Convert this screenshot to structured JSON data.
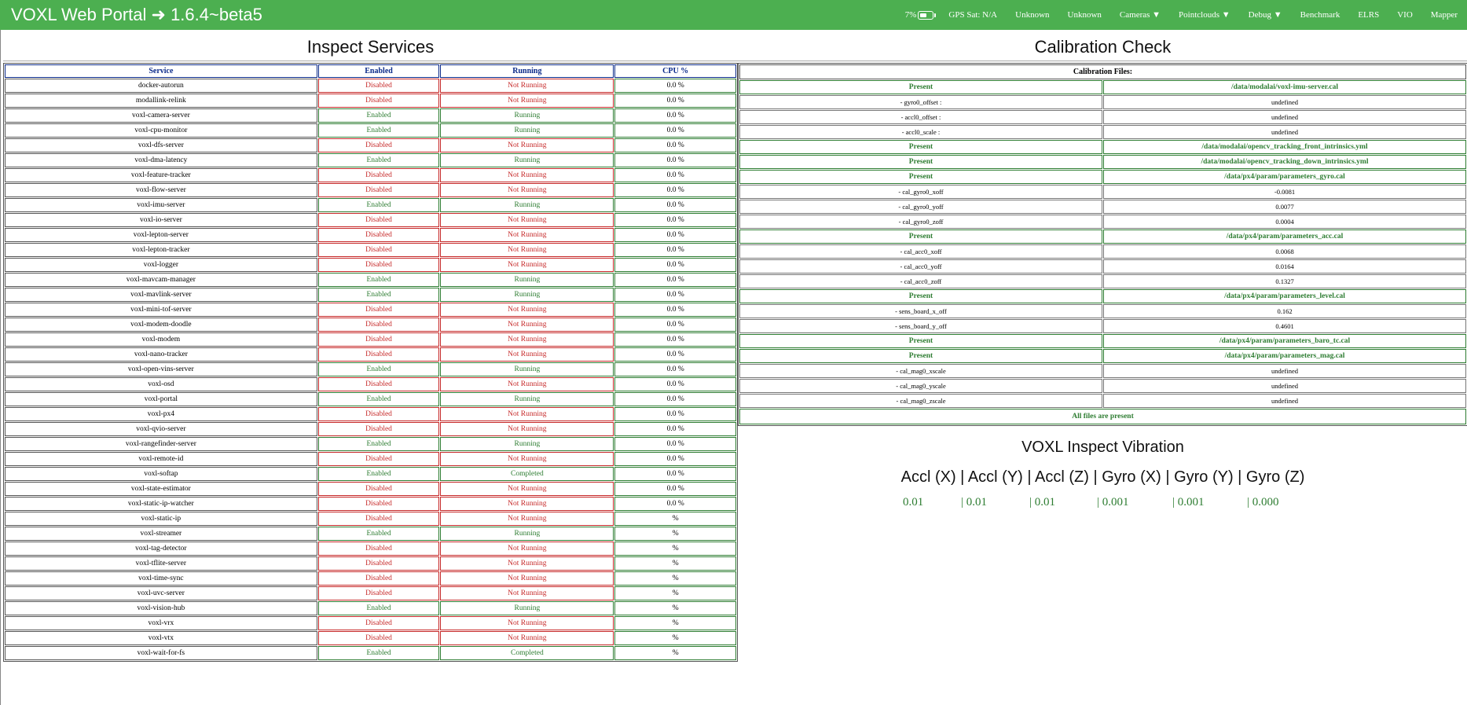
{
  "header": {
    "title": "VOXL Web Portal ➜ 1.6.4~beta5",
    "battery": "7%",
    "gps": "GPS Sat: N/A",
    "status1": "Unknown",
    "status2": "Unknown",
    "nav": [
      "Cameras ▼",
      "Pointclouds ▼",
      "Debug ▼",
      "Benchmark",
      "ELRS",
      "VIO",
      "Mapper"
    ]
  },
  "services": {
    "title": "Inspect Services",
    "columns": [
      "Service",
      "Enabled",
      "Running",
      "CPU %"
    ],
    "rows": [
      [
        "docker-autorun",
        "Disabled",
        "Not Running",
        "0.0 %"
      ],
      [
        "modallink-relink",
        "Disabled",
        "Not Running",
        "0.0 %"
      ],
      [
        "voxl-camera-server",
        "Enabled",
        "Running",
        "0.0 %"
      ],
      [
        "voxl-cpu-monitor",
        "Enabled",
        "Running",
        "0.0 %"
      ],
      [
        "voxl-dfs-server",
        "Disabled",
        "Not Running",
        "0.0 %"
      ],
      [
        "voxl-dma-latency",
        "Enabled",
        "Running",
        "0.0 %"
      ],
      [
        "voxl-feature-tracker",
        "Disabled",
        "Not Running",
        "0.0 %"
      ],
      [
        "voxl-flow-server",
        "Disabled",
        "Not Running",
        "0.0 %"
      ],
      [
        "voxl-imu-server",
        "Enabled",
        "Running",
        "0.0 %"
      ],
      [
        "voxl-io-server",
        "Disabled",
        "Not Running",
        "0.0 %"
      ],
      [
        "voxl-lepton-server",
        "Disabled",
        "Not Running",
        "0.0 %"
      ],
      [
        "voxl-lepton-tracker",
        "Disabled",
        "Not Running",
        "0.0 %"
      ],
      [
        "voxl-logger",
        "Disabled",
        "Not Running",
        "0.0 %"
      ],
      [
        "voxl-mavcam-manager",
        "Enabled",
        "Running",
        "0.0 %"
      ],
      [
        "voxl-mavlink-server",
        "Enabled",
        "Running",
        "0.0 %"
      ],
      [
        "voxl-mini-tof-server",
        "Disabled",
        "Not Running",
        "0.0 %"
      ],
      [
        "voxl-modem-doodle",
        "Disabled",
        "Not Running",
        "0.0 %"
      ],
      [
        "voxl-modem",
        "Disabled",
        "Not Running",
        "0.0 %"
      ],
      [
        "voxl-nano-tracker",
        "Disabled",
        "Not Running",
        "0.0 %"
      ],
      [
        "voxl-open-vins-server",
        "Enabled",
        "Running",
        "0.0 %"
      ],
      [
        "voxl-osd",
        "Disabled",
        "Not Running",
        "0.0 %"
      ],
      [
        "voxl-portal",
        "Enabled",
        "Running",
        "0.0 %"
      ],
      [
        "voxl-px4",
        "Disabled",
        "Not Running",
        "0.0 %"
      ],
      [
        "voxl-qvio-server",
        "Disabled",
        "Not Running",
        "0.0 %"
      ],
      [
        "voxl-rangefinder-server",
        "Enabled",
        "Running",
        "0.0 %"
      ],
      [
        "voxl-remote-id",
        "Disabled",
        "Not Running",
        "0.0 %"
      ],
      [
        "voxl-softap",
        "Enabled",
        "Completed",
        "0.0 %"
      ],
      [
        "voxl-state-estimator",
        "Disabled",
        "Not Running",
        "0.0 %"
      ],
      [
        "voxl-static-ip-watcher",
        "Disabled",
        "Not Running",
        "0.0 %"
      ],
      [
        "voxl-static-ip",
        "Disabled",
        "Not Running",
        "%"
      ],
      [
        "voxl-streamer",
        "Enabled",
        "Running",
        "%"
      ],
      [
        "voxl-tag-detector",
        "Disabled",
        "Not Running",
        "%"
      ],
      [
        "voxl-tflite-server",
        "Disabled",
        "Not Running",
        "%"
      ],
      [
        "voxl-time-sync",
        "Disabled",
        "Not Running",
        "%"
      ],
      [
        "voxl-uvc-server",
        "Disabled",
        "Not Running",
        "%"
      ],
      [
        "voxl-vision-hub",
        "Enabled",
        "Running",
        "%"
      ],
      [
        "voxl-vrx",
        "Disabled",
        "Not Running",
        "%"
      ],
      [
        "voxl-vtx",
        "Disabled",
        "Not Running",
        "%"
      ],
      [
        "voxl-wait-for-fs",
        "Enabled",
        "Completed",
        "%"
      ]
    ]
  },
  "calibration": {
    "title": "Calibration Check",
    "header": "Calibration Files:",
    "rows": [
      {
        "kind": "file",
        "status": "Present",
        "path": "/data/modalai/voxl-imu-server.cal"
      },
      {
        "kind": "param",
        "name": "- gyro0_offset :",
        "value": "undefined"
      },
      {
        "kind": "param",
        "name": "- accl0_offset :",
        "value": "undefined"
      },
      {
        "kind": "param",
        "name": "- accl0_scale :",
        "value": "undefined"
      },
      {
        "kind": "file",
        "status": "Present",
        "path": "/data/modalai/opencv_tracking_front_intrinsics.yml"
      },
      {
        "kind": "file",
        "status": "Present",
        "path": "/data/modalai/opencv_tracking_down_intrinsics.yml"
      },
      {
        "kind": "file",
        "status": "Present",
        "path": "/data/px4/param/parameters_gyro.cal"
      },
      {
        "kind": "param",
        "name": "- cal_gyro0_xoff",
        "value": "-0.0081"
      },
      {
        "kind": "param",
        "name": "- cal_gyro0_yoff",
        "value": "0.0077"
      },
      {
        "kind": "param",
        "name": "- cal_gyro0_zoff",
        "value": "0.0004"
      },
      {
        "kind": "file",
        "status": "Present",
        "path": "/data/px4/param/parameters_acc.cal"
      },
      {
        "kind": "param",
        "name": "- cal_acc0_xoff",
        "value": "0.0068"
      },
      {
        "kind": "param",
        "name": "- cal_acc0_yoff",
        "value": "0.0164"
      },
      {
        "kind": "param",
        "name": "- cal_acc0_zoff",
        "value": "0.1327"
      },
      {
        "kind": "file",
        "status": "Present",
        "path": "/data/px4/param/parameters_level.cal"
      },
      {
        "kind": "param",
        "name": "- sens_board_x_off",
        "value": "0.162"
      },
      {
        "kind": "param",
        "name": "- sens_board_y_off",
        "value": "0.4601"
      },
      {
        "kind": "file",
        "status": "Present",
        "path": "/data/px4/param/parameters_baro_tc.cal"
      },
      {
        "kind": "file",
        "status": "Present",
        "path": "/data/px4/param/parameters_mag.cal"
      },
      {
        "kind": "param",
        "name": "- cal_mag0_xscale",
        "value": "undefined"
      },
      {
        "kind": "param",
        "name": "- cal_mag0_yscale",
        "value": "undefined"
      },
      {
        "kind": "param",
        "name": "- cal_mag0_zscale",
        "value": "undefined"
      }
    ],
    "footer": "All files are present"
  },
  "vibration": {
    "title": "VOXL Inspect Vibration",
    "header": "Accl (X) | Accl (Y) | Accl (Z) | Gyro (X) | Gyro (Y) | Gyro (Z)",
    "values": [
      "0.01",
      "| 0.01",
      "| 0.01",
      "| 0.001",
      "| 0.001",
      "| 0.000"
    ]
  },
  "colors": {
    "topbar": "#4caf50",
    "good": "#2e7d32",
    "bad": "#c62828",
    "header_blue": "#0a2a8a"
  }
}
